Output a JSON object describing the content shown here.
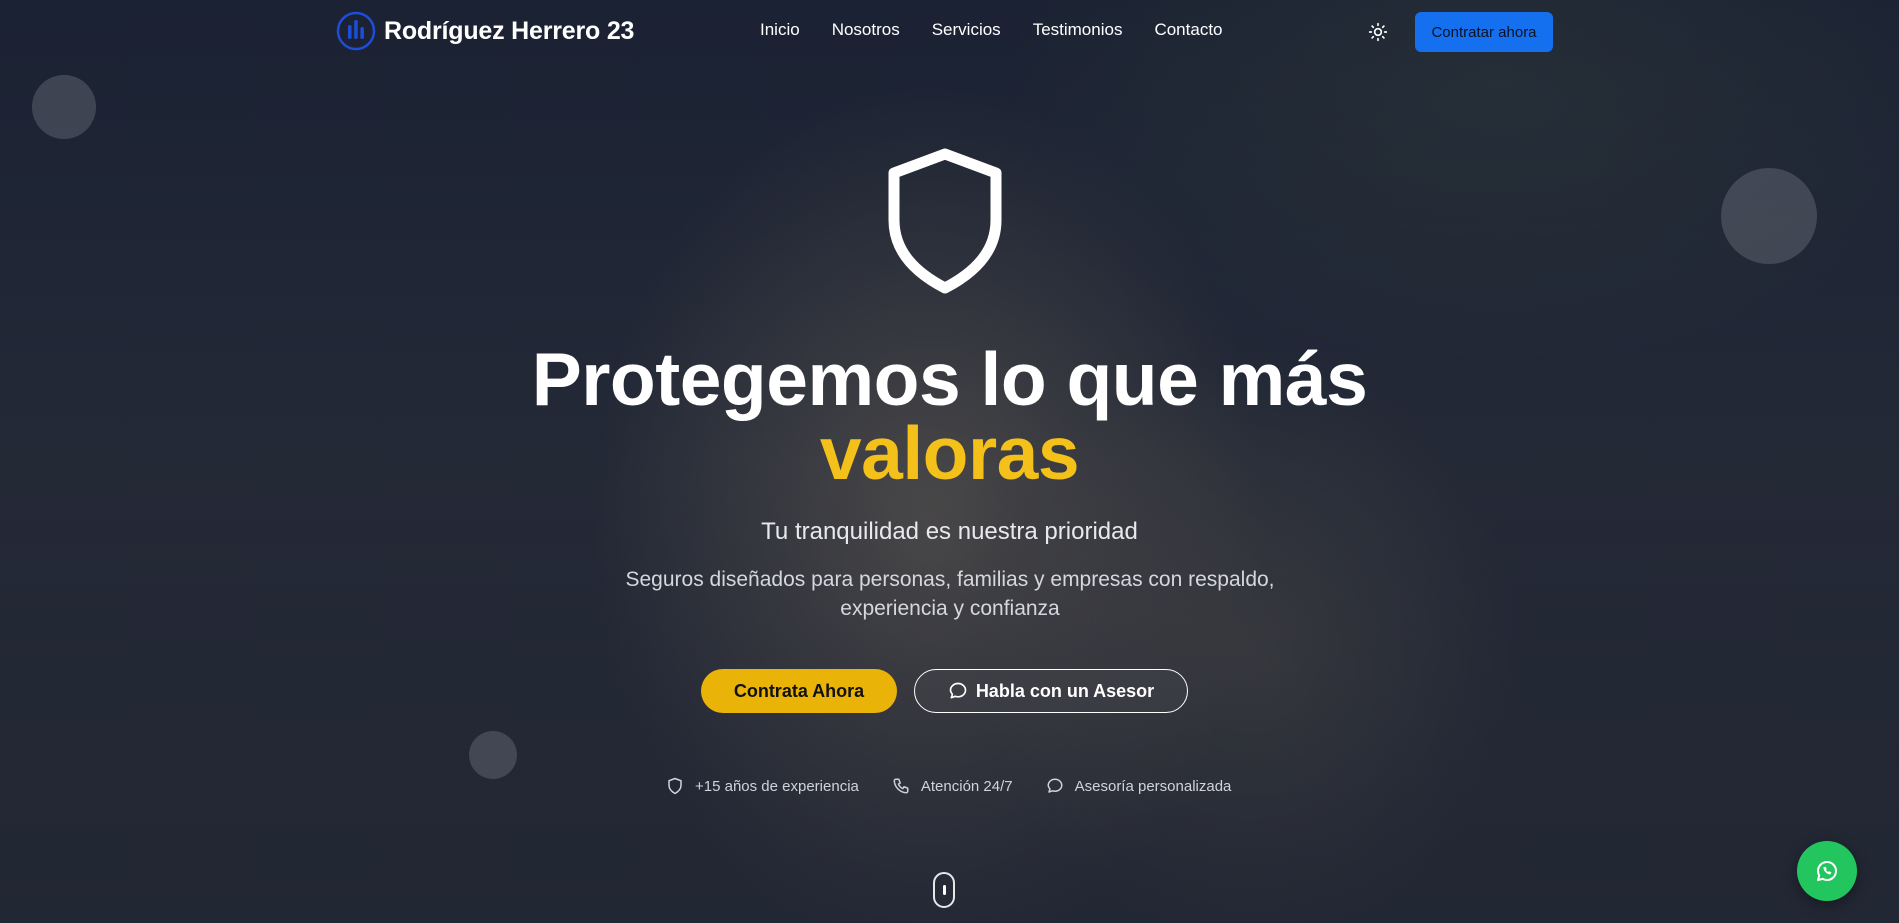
{
  "brand": {
    "name": "Rodríguez Herrero 23",
    "logo_icon": "bar-chart-circle-icon",
    "logo_color": "#1d4ed8"
  },
  "nav": {
    "items": [
      {
        "label": "Inicio"
      },
      {
        "label": "Nosotros"
      },
      {
        "label": "Servicios"
      },
      {
        "label": "Testimonios"
      },
      {
        "label": "Contacto"
      }
    ],
    "theme_icon": "sun-icon",
    "cta_label": "Contratar ahora",
    "cta_color": "#1570ef"
  },
  "hero": {
    "icon": "shield-icon",
    "headline_main": "Protegemos lo que más",
    "headline_accent": "valoras",
    "accent_color": "#f3c11a",
    "subtitle": "Tu tranquilidad es nuestra prioridad",
    "description": "Seguros diseñados para personas, familias y empresas con respaldo, experiencia y confianza",
    "primary_button": "Contrata Ahora",
    "primary_color": "#eab308",
    "secondary_button": "Habla con un Asesor",
    "secondary_icon": "chat-bubble-icon"
  },
  "features": [
    {
      "icon": "shield-icon",
      "label": "+15 años de experiencia"
    },
    {
      "icon": "phone-icon",
      "label": "Atención 24/7"
    },
    {
      "icon": "chat-bubble-icon",
      "label": "Asesoría personalizada"
    }
  ],
  "floating": {
    "whatsapp_icon": "whatsapp-icon",
    "whatsapp_color": "#22c55e",
    "scroll_icon": "mouse-scroll-icon"
  }
}
